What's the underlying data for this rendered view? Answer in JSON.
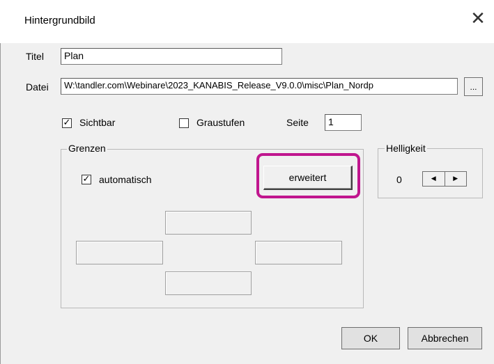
{
  "window": {
    "title": "Hintergrundbild",
    "close_glyph": "✕"
  },
  "fields": {
    "titel_label": "Titel",
    "titel_value": "Plan",
    "datei_label": "Datei",
    "datei_value": "W:\\tandler.com\\Webinare\\2023_KANABIS_Release_V9.0.0\\misc\\Plan_Nordp",
    "browse_label": "...",
    "seite_label": "Seite",
    "seite_value": "1"
  },
  "options": {
    "sichtbar_label": "Sichtbar",
    "sichtbar_checked": true,
    "graustufen_label": "Graustufen",
    "graustufen_checked": false
  },
  "grenzen": {
    "legend": "Grenzen",
    "automatisch_label": "automatisch",
    "automatisch_checked": true,
    "erweitert_label": "erweitert",
    "top_value": "",
    "left_value": "",
    "right_value": "",
    "bottom_value": ""
  },
  "helligkeit": {
    "legend": "Helligkeit",
    "value": "0",
    "left_arrow": "◀",
    "right_arrow": "▶"
  },
  "buttons": {
    "ok_label": "OK",
    "cancel_label": "Abbrechen"
  },
  "colors": {
    "highlight": "#c0168e",
    "dialog_bg": "#f0f0f0"
  }
}
